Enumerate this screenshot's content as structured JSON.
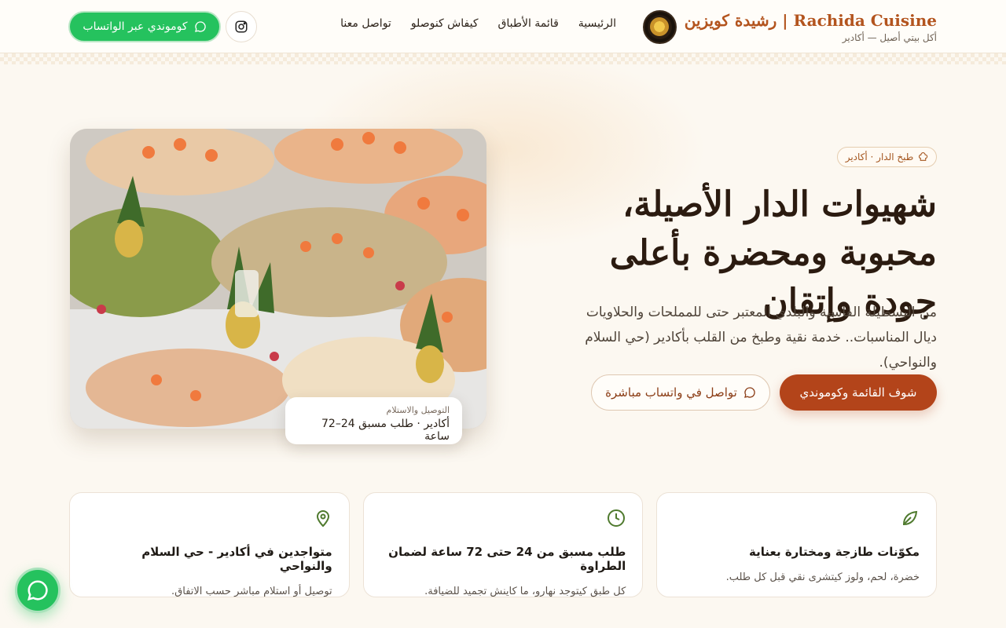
{
  "header": {
    "brand_title": "Rachida Cuisine | رشيدة كويزين",
    "brand_subtitle": "أكل بيتي أصيل — أكادير",
    "nav": [
      {
        "label": "الرئيسية"
      },
      {
        "label": "قائمة الأطباق"
      },
      {
        "label": "كيفاش كنوصلو"
      },
      {
        "label": "تواصل معنا"
      }
    ],
    "whatsapp_button": "كوموندي عبر الواتساب",
    "instagram_icon": "instagram-icon"
  },
  "hero": {
    "badge": "طبخ الدار · أكادير",
    "title": "شهيوات الدار الأصيلة، محبوبة ومحضرة بأعلى جودة وإتقان",
    "description": "من البسطيلة الفاسية والبلدي المعتبر حتى للمملحات والحلاويات ديال المناسبات.. خدمة نقية وطبخ من القلب بأكادير (حي السلام والنواحي).",
    "primary_button": "شوف القائمة وكوموندي",
    "secondary_button": "تواصل في واتساب مباشرة",
    "delivery_label": "التوصيل والاستلام",
    "delivery_value": "أكادير · طلب مسبق 24–72 ساعة"
  },
  "features": [
    {
      "icon": "leaf-icon",
      "title": "مكوّنات طازجة ومختارة بعناية",
      "desc": "خضرة، لحم، ولوز كيتشرى نقي قبل كل طلب."
    },
    {
      "icon": "clock-icon",
      "title": "طلب مسبق من 24 حتى 72 ساعة لضمان الطراوة",
      "desc": "كل طبق كيتوجد نهارو، ما كاينش تجميد للضيافة."
    },
    {
      "icon": "location-pin-icon",
      "title": "متواجدين في أكادير - حي السلام والنواحي",
      "desc": "توصيل أو استلام مباشر حسب الاتفاق."
    }
  ],
  "colors": {
    "accent": "#b3441a",
    "whatsapp": "#25c25e",
    "background": "#fcf8f1"
  }
}
